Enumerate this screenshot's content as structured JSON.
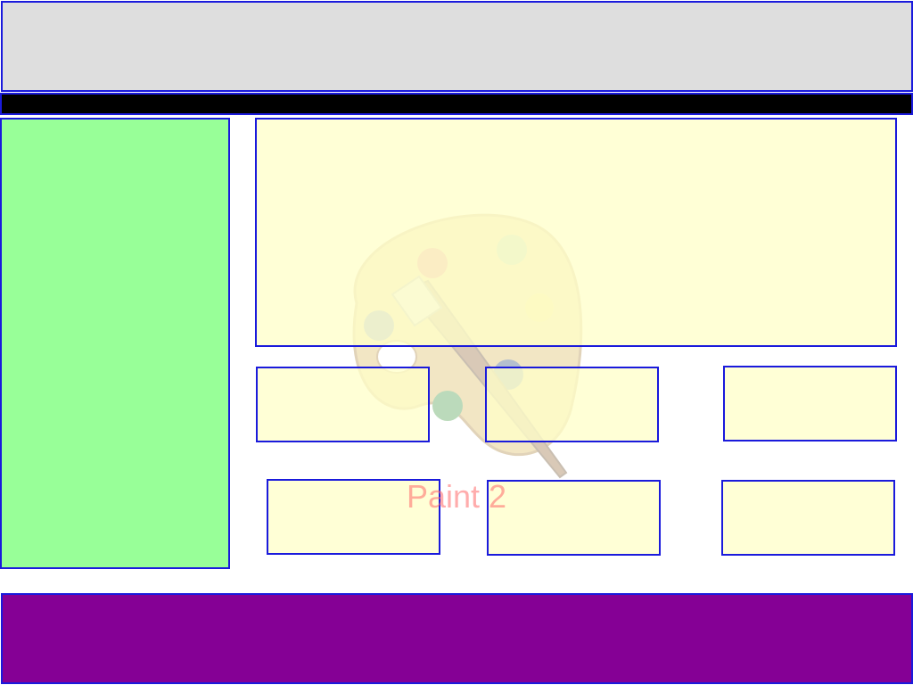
{
  "watermark": {
    "app_name": "Paint 2",
    "icon": "paint-palette-icon"
  },
  "colors": {
    "header_bg": "#dedede",
    "menubar_bg": "#000000",
    "sidebar_bg": "#98ff98",
    "panel_bg": "#ffffd8",
    "footer_bg": "#850095",
    "border": "#1a1adc",
    "watermark_text": "#ff6a6a"
  }
}
